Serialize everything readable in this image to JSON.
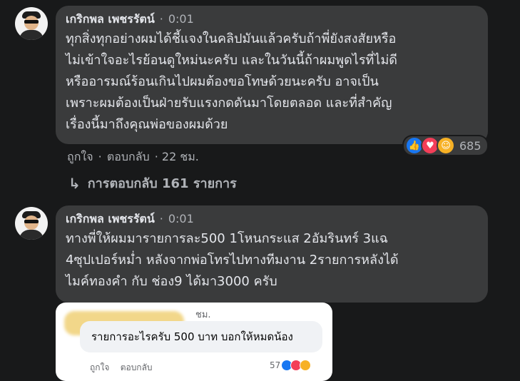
{
  "comments": [
    {
      "author": "เกริกพล เพชรรัตน์",
      "separator": "·",
      "time": "0:01",
      "text": "ทุกสิ่งทุกอย่างผมได้ชี้แจงในคลิปมันแล้วครับถ้าพี่ยังสงสัยหรือ\nไม่เข้าใจอะไรย้อนดูใหม่นะครับ และในวันนี้ถ้าผมพูดไรที่ไม่ดี\nหรืออารมณ์ร้อนเกินไปผมต้องขอโทษด้วยนะครับ อาจเป็น\nเพราะผมต้องเป็นฝ่ายรับแรงกดดันมาโดยตลอด และที่สำคัญ\nเรื่องนี้มาถึงคุณพ่อของผมด้วย",
      "like_label": "ถูกใจ",
      "dot": "·",
      "reply_label": "ตอบกลับ",
      "age": "· 22 ชม.",
      "reaction_count": "685",
      "reaction_icons": [
        "like-icon",
        "love-icon",
        "care-icon"
      ]
    },
    {
      "author": "เกริกพล เพชรรัตน์",
      "separator": "·",
      "time": "0:01",
      "text": "ทางพี่ให้ผมมารายการละ500 1โหนกระแส 2อัมรินทร์ 3แฉ\n4ซุปเปอร์หม่ำ หลังจากพ่อโทรไปทางทีมงาน 2รายการหลังได้\nไมค์ทองคำ กับ ช่อง9 ได้มา3000 ครับ"
    }
  ],
  "replies_link": {
    "arrow": "↳",
    "label": "การตอบกลับ 161 รายการ"
  },
  "attached_screenshot": {
    "time": "ชม.",
    "text": "รายการอะไรครับ 500 บาท บอกให้หมดน้อง",
    "like_label": "ถูกใจ",
    "reply_label": "ตอบกลับ",
    "reaction_count": "57"
  },
  "colors": {
    "background": "#18191a",
    "bubble": "#3a3b3c",
    "text": "#e4e6eb",
    "muted": "#b0b3b8",
    "like": "#1877f2",
    "love": "#f33e58",
    "care": "#f7b125"
  }
}
